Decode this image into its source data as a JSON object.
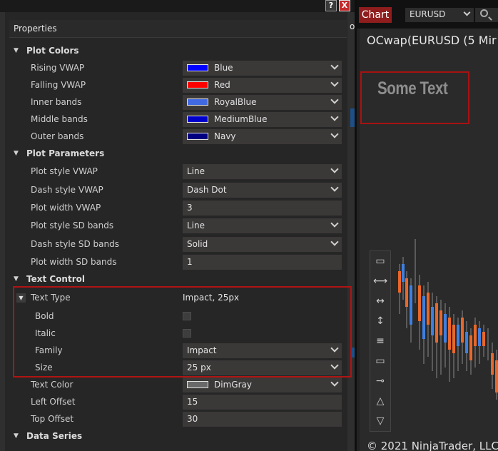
{
  "dialog": {
    "help_label": "?",
    "close_label": "X",
    "peek_text": "o",
    "header": "Properties"
  },
  "categories": {
    "plot_colors": "Plot Colors",
    "plot_parameters": "Plot Parameters",
    "text_control": "Text Control",
    "data_series": "Data Series"
  },
  "rows": {
    "rising_vwap": {
      "label": "Rising VWAP",
      "value": "Blue",
      "color": "#0000ff"
    },
    "falling_vwap": {
      "label": "Falling VWAP",
      "value": "Red",
      "color": "#ff0000"
    },
    "inner_bands": {
      "label": "Inner bands",
      "value": "RoyalBlue",
      "color": "#4169e1"
    },
    "middle_bands": {
      "label": "Middle bands",
      "value": "MediumBlue",
      "color": "#0000cd"
    },
    "outer_bands": {
      "label": "Outer bands",
      "value": "Navy",
      "color": "#000080"
    },
    "plot_style_vwap": {
      "label": "Plot style VWAP",
      "value": "Line"
    },
    "dash_style_vwap": {
      "label": "Dash style VWAP",
      "value": "Dash Dot"
    },
    "plot_width_vwap": {
      "label": "Plot width VWAP",
      "value": "3"
    },
    "plot_style_sd": {
      "label": "Plot style SD bands",
      "value": "Line"
    },
    "dash_style_sd": {
      "label": "Dash style SD bands",
      "value": "Solid"
    },
    "plot_width_sd": {
      "label": "Plot width SD bands",
      "value": "1"
    },
    "text_type": {
      "label": "Text Type",
      "value": "Impact, 25px"
    },
    "bold": {
      "label": "Bold",
      "checked": false
    },
    "italic": {
      "label": "Italic",
      "checked": false
    },
    "family": {
      "label": "Family",
      "value": "Impact"
    },
    "size": {
      "label": "Size",
      "value": "25 px"
    },
    "text_color": {
      "label": "Text Color",
      "value": "DimGray",
      "color": "#696969"
    },
    "left_offset": {
      "label": "Left Offset",
      "value": "15"
    },
    "top_offset": {
      "label": "Top Offset",
      "value": "30"
    }
  },
  "chart": {
    "tab_label": "Chart",
    "instrument": "EURUSD",
    "title": "OCwap(EURUSD (5 Mir",
    "overlay_text": "Some Text",
    "copyright": "© 2021 NinjaTrader, LLC"
  },
  "icons": {
    "expand": "triangle-down-icon",
    "dropdown": "chevron-down-icon",
    "search": "search-icon"
  }
}
